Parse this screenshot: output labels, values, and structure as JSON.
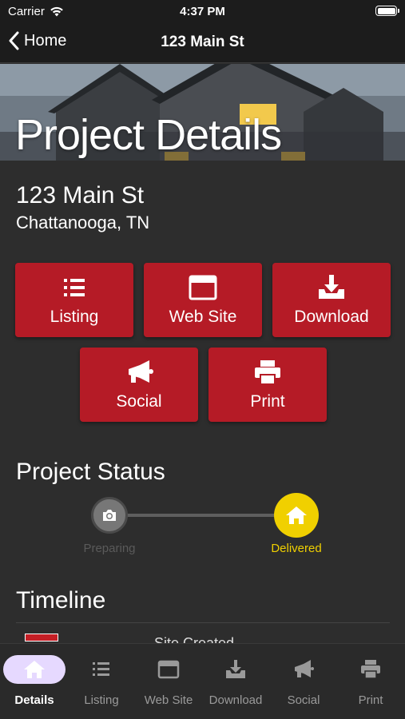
{
  "status_bar": {
    "carrier": "Carrier",
    "time": "4:37 PM"
  },
  "nav": {
    "back_label": "Home",
    "title": "123 Main St"
  },
  "hero": {
    "heading": "Project Details"
  },
  "address": {
    "street": "123 Main St",
    "city": "Chattanooga, TN"
  },
  "actions": [
    {
      "label": "Listing",
      "icon": "list-icon"
    },
    {
      "label": "Web Site",
      "icon": "browser-window-icon"
    },
    {
      "label": "Download",
      "icon": "download-tray-icon"
    },
    {
      "label": "Social",
      "icon": "megaphone-icon"
    },
    {
      "label": "Print",
      "icon": "printer-icon"
    }
  ],
  "status": {
    "heading": "Project Status",
    "steps": [
      {
        "label": "Preparing",
        "icon": "camera-icon",
        "state": "inactive"
      },
      {
        "label": "Delivered",
        "icon": "home-icon",
        "state": "active"
      }
    ]
  },
  "timeline": {
    "heading": "Timeline",
    "first_item": "Site Created"
  },
  "tabs": [
    {
      "label": "Details",
      "icon": "home-icon",
      "active": true
    },
    {
      "label": "Listing",
      "icon": "list-icon",
      "active": false
    },
    {
      "label": "Web Site",
      "icon": "browser-window-icon",
      "active": false
    },
    {
      "label": "Download",
      "icon": "download-tray-icon",
      "active": false
    },
    {
      "label": "Social",
      "icon": "megaphone-icon",
      "active": false
    },
    {
      "label": "Print",
      "icon": "printer-icon",
      "active": false
    }
  ],
  "colors": {
    "accent_red": "#b51b26",
    "delivered_yellow": "#f0d000",
    "active_tab_pill": "#e6d9ff"
  }
}
